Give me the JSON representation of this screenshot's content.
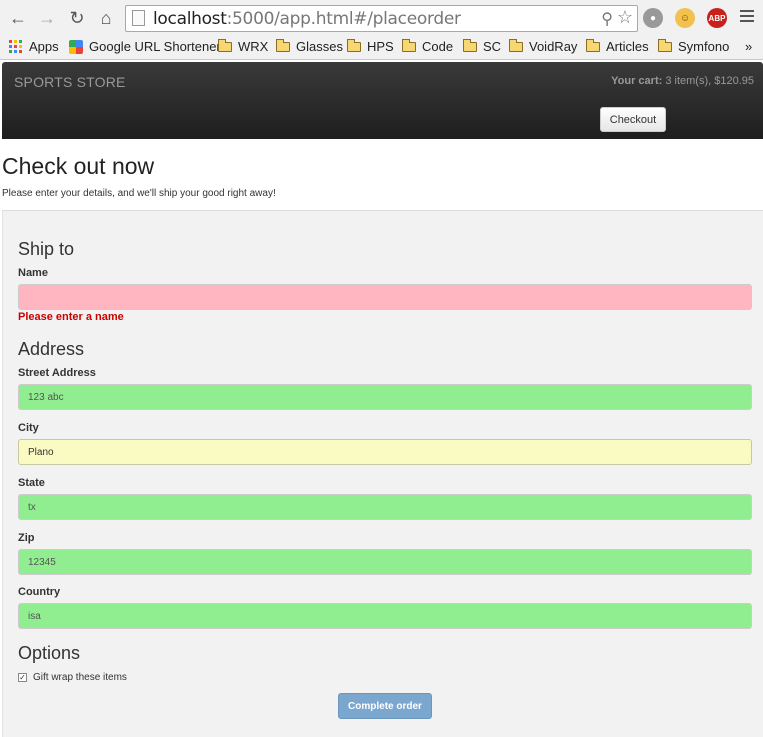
{
  "browser": {
    "url_host": "localhost",
    "url_rest": ":5000/app.html#/placeorder",
    "bookmarks": [
      {
        "label": "Apps"
      },
      {
        "label": "Google URL Shortener"
      },
      {
        "label": "WRX"
      },
      {
        "label": "Glasses"
      },
      {
        "label": "HPS"
      },
      {
        "label": "Code"
      },
      {
        "label": "SC"
      },
      {
        "label": "VoidRay"
      },
      {
        "label": "Articles"
      },
      {
        "label": "Symfono"
      }
    ],
    "overflow": "»",
    "abp_label": "ABP"
  },
  "navbar": {
    "brand": "SPORTS STORE",
    "cart_label": "Your cart:",
    "cart_summary": "3 item(s), $120.95",
    "checkout_button": "Checkout"
  },
  "page": {
    "title": "Check out now",
    "subtitle": "Please enter your details, and we'll ship your good right away!"
  },
  "form": {
    "ship_to_heading": "Ship to",
    "name_label": "Name",
    "name_value": "",
    "name_error": "Please enter a name",
    "address_heading": "Address",
    "street_label": "Street Address",
    "street_value": "123 abc",
    "city_label": "City",
    "city_value": "Plano",
    "state_label": "State",
    "state_value": "tx",
    "zip_label": "Zip",
    "zip_value": "12345",
    "country_label": "Country",
    "country_value": "isa",
    "options_heading": "Options",
    "giftwrap_label": "Gift wrap these items",
    "giftwrap_checked": true,
    "complete_button": "Complete order"
  },
  "colors": {
    "invalid": "#ffb6c1",
    "valid": "#90ee90",
    "focused": "#fafbc2",
    "error_text": "#cc0000",
    "primary_button": "#7ba7cf"
  }
}
